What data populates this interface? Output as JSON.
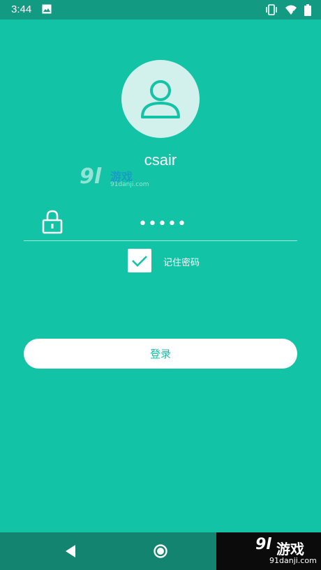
{
  "status_bar": {
    "time": "3:44",
    "icons": [
      "image-icon",
      "vibrate-icon",
      "wifi-icon",
      "battery-icon"
    ]
  },
  "profile": {
    "avatar_icon": "user-icon",
    "username": "csair"
  },
  "watermark": {
    "logo_number": "9l",
    "logo_text": "游戏",
    "logo_url": "91danji.com"
  },
  "password": {
    "icon": "lock-icon",
    "value": "•••••"
  },
  "remember": {
    "checked": true,
    "label": "记住密码"
  },
  "login": {
    "label": "登录"
  },
  "nav_bar": {
    "icons": [
      "back-icon",
      "home-icon"
    ]
  },
  "colors": {
    "background": "#13c3a5",
    "status_bar": "#139a83",
    "nav_bar": "#13846f",
    "avatar_bg": "#d2f0ec",
    "avatar_icon": "#13c3a5"
  }
}
